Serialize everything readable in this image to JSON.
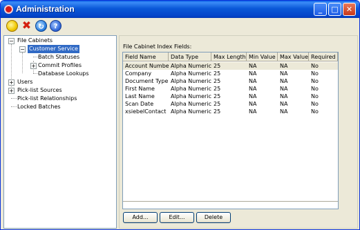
{
  "window": {
    "title": "Administration",
    "min_glyph": "_",
    "max_glyph": "□",
    "close_glyph": "✕"
  },
  "toolbar": {
    "new_icon": "new-icon",
    "delete_icon": "delete-icon",
    "refresh_icon": "refresh-icon",
    "help_icon": "help-icon",
    "delete_glyph": "✖",
    "help_glyph": "?",
    "refresh_glyph": "↻"
  },
  "tree": {
    "expand_glyph": "+",
    "collapse_glyph": "−",
    "nodes": {
      "file_cabinets": "File Cabinets",
      "customer_service": "Customer Service",
      "batch_statuses": "Batch Statuses",
      "commit_profiles": "Commit Profiles",
      "database_lookups": "Database Lookups",
      "users": "Users",
      "picklist_sources": "Pick-list Sources",
      "picklist_relationships": "Pick-list Relationships",
      "locked_batches": "Locked Batches"
    }
  },
  "panel": {
    "title": "File Cabinet Index Fields:",
    "columns": [
      "Field Name",
      "Data Type",
      "Max Length",
      "Min Value",
      "Max Value",
      "Required"
    ],
    "rows": [
      [
        "Account Number",
        "Alpha Numeric",
        "25",
        "NA",
        "NA",
        "No"
      ],
      [
        "Company",
        "Alpha Numeric",
        "25",
        "NA",
        "NA",
        "No"
      ],
      [
        "Document Type",
        "Alpha Numeric",
        "25",
        "NA",
        "NA",
        "No"
      ],
      [
        "First Name",
        "Alpha Numeric",
        "25",
        "NA",
        "NA",
        "No"
      ],
      [
        "Last Name",
        "Alpha Numeric",
        "25",
        "NA",
        "NA",
        "No"
      ],
      [
        "Scan Date",
        "Alpha Numeric",
        "25",
        "NA",
        "NA",
        "No"
      ],
      [
        "xsiebelContact",
        "Alpha Numeric",
        "25",
        "NA",
        "NA",
        "No"
      ]
    ],
    "buttons": {
      "add": "Add...",
      "edit": "Edit...",
      "delete": "Delete"
    }
  },
  "colors": {
    "titlebar": "#0a58d8",
    "selection": "#316ac5",
    "window_bg": "#ece9d8"
  }
}
